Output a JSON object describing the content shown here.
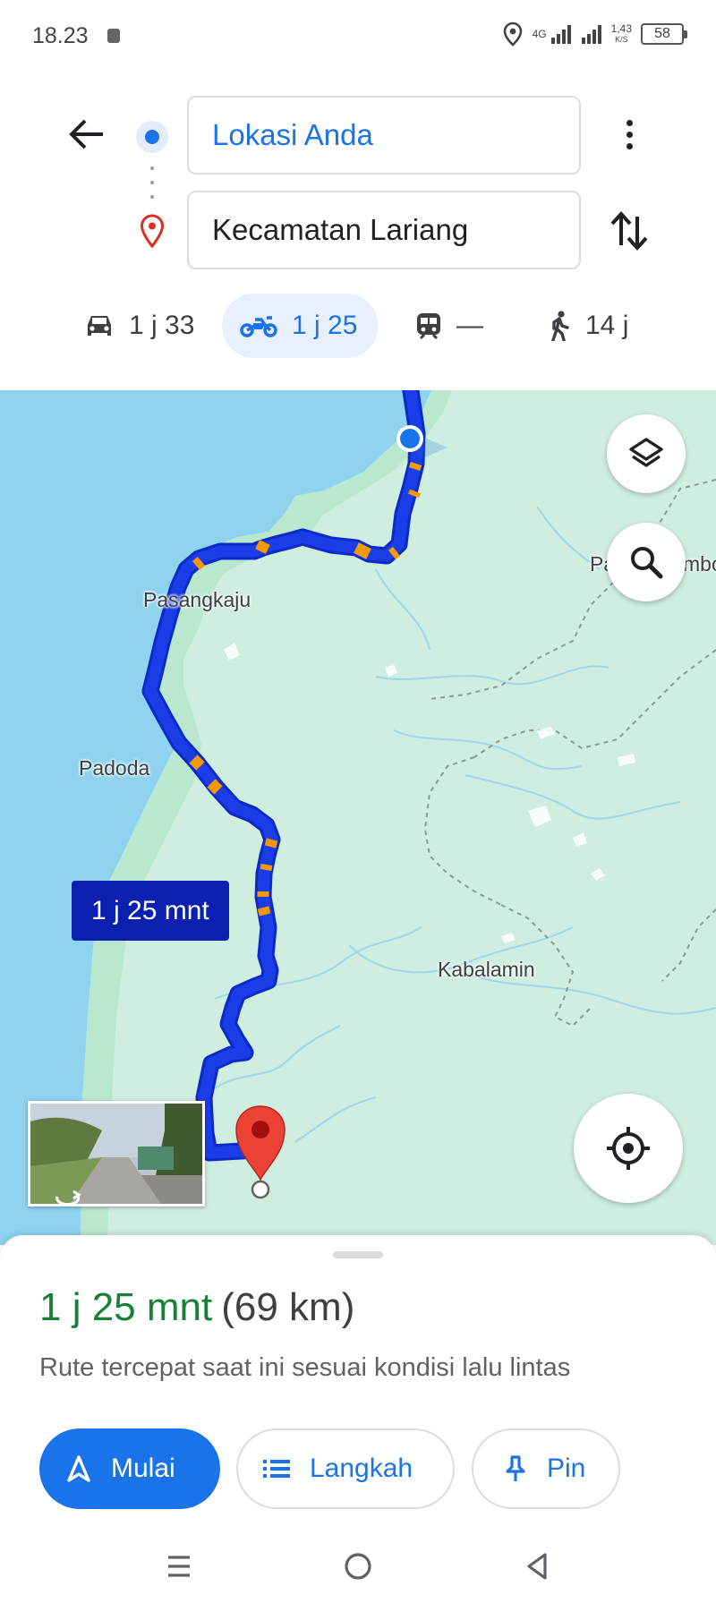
{
  "status_bar": {
    "time": "18.23",
    "network": "4G",
    "speed_value": "1,43",
    "speed_unit": "K/S",
    "battery": "58"
  },
  "directions": {
    "origin": "Lokasi Anda",
    "destination": "Kecamatan Lariang"
  },
  "modes": {
    "car": "1 j 33",
    "motorcycle": "1 j 25",
    "transit": "—",
    "walk": "14 j"
  },
  "map": {
    "labels": {
      "pasangkaju": "Pasangkaju",
      "padoda": "Padoda",
      "kabalamin": "Kabalamin",
      "partial_left": "Pa",
      "partial_right": "mbo"
    },
    "route_duration_label": "1 j 25 mnt",
    "route_color": "#1a3de8",
    "traffic_color": "#f29900",
    "destination_pin_color": "#d93025"
  },
  "sheet": {
    "eta_time": "1 j 25 mnt",
    "eta_distance": "(69 km)",
    "route_note": "Rute tercepat saat ini sesuai kondisi lalu lintas",
    "start_label": "Mulai",
    "steps_label": "Langkah",
    "pin_label": "Pin"
  },
  "colors": {
    "accent": "#1a73e8",
    "eta_green": "#188038",
    "water": "#8fd3f0",
    "land": "#cfeee0"
  }
}
